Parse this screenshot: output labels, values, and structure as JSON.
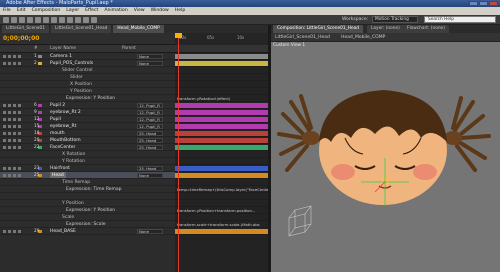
{
  "window": {
    "title": "Adobe After Effects - MaloParts_Pupil.aep *"
  },
  "menu": [
    "File",
    "Edit",
    "Composition",
    "Layer",
    "Effect",
    "Animation",
    "View",
    "Window",
    "Help"
  ],
  "toolbar": {
    "workspace_label": "Workspace:",
    "workspace_value": "Motion Tracking",
    "search_placeholder": "Search Help"
  },
  "timeline": {
    "tabs": [
      "LittleGirl_Scene01",
      "LittleGirl_Scene01_Head",
      "Head_Mobile_COMP"
    ],
    "timecode": "0;00;00;00",
    "ruler": [
      "00s",
      "05s",
      "10s"
    ],
    "columns": {
      "num": "#",
      "source": "Layer Name",
      "parent": "Parent"
    },
    "layers": [
      {
        "num": "1",
        "name": "Camera 1",
        "parent": "None",
        "label": "#8a8a8a",
        "bar": "#8a8a8a",
        "kind": "layer"
      },
      {
        "num": "2",
        "name": "Pupil_POS_Controls",
        "parent": "None",
        "label": "#c9b640",
        "bar": "#c9b640",
        "kind": "layer"
      },
      {
        "num": "",
        "name": "Slider Control",
        "parent": "",
        "label": "",
        "bar": "",
        "kind": "sub"
      },
      {
        "num": "",
        "name": "Slider",
        "parent": "",
        "label": "",
        "bar": "",
        "kind": "sub2"
      },
      {
        "num": "",
        "name": "X Position",
        "parent": "",
        "label": "",
        "bar": "",
        "kind": "sub2"
      },
      {
        "num": "",
        "name": "Y Position",
        "parent": "",
        "label": "",
        "bar": "",
        "kind": "sub2"
      },
      {
        "num": "",
        "name": "Expression: Y Position",
        "parent": "",
        "label": "",
        "bar": "",
        "expr": "transform.yRotation!(effect)",
        "kind": "prop"
      },
      {
        "num": "6",
        "name": "Pupil 2",
        "parent": "12. Pupil_R",
        "label": "#b23bb0",
        "bar": "#b23bb0",
        "kind": "layer"
      },
      {
        "num": "9",
        "name": "eyebrow_Rt 2",
        "parent": "12. Pupil_R",
        "label": "#b23bb0",
        "bar": "#b23bb0",
        "kind": "layer"
      },
      {
        "num": "12",
        "name": "Pupil",
        "parent": "12. Pupil_R",
        "label": "#b23bb0",
        "bar": "#b23bb0",
        "kind": "layer"
      },
      {
        "num": "15",
        "name": "eyebrow_Rt",
        "parent": "12. Pupil_R",
        "label": "#b23bb0",
        "bar": "#b23bb0",
        "kind": "layer"
      },
      {
        "num": "18",
        "name": "mouth",
        "parent": "25. Head",
        "label": "#b8413a",
        "bar": "#b8413a",
        "kind": "layer"
      },
      {
        "num": "20",
        "name": "MouthBottom",
        "parent": "25. Head",
        "label": "#b8413a",
        "bar": "#b8413a",
        "kind": "layer"
      },
      {
        "num": "22",
        "name": "FaceCenter",
        "parent": "25. Head",
        "label": "#3aa86a",
        "bar": "#3aa86a",
        "kind": "layer"
      },
      {
        "num": "",
        "name": "X Rotation",
        "parent": "",
        "label": "",
        "bar": "",
        "kind": "sub"
      },
      {
        "num": "",
        "name": "Y Rotation",
        "parent": "",
        "label": "",
        "bar": "",
        "kind": "sub"
      },
      {
        "num": "23",
        "name": "Hairfront",
        "parent": "25. Head",
        "label": "#3b5cc4",
        "bar": "#3b5cc4",
        "kind": "layer"
      },
      {
        "num": "25",
        "name": "Head",
        "parent": "None",
        "label": "#d48a1e",
        "bar": "#d48a1e",
        "kind": "layer",
        "selected": true
      },
      {
        "num": "",
        "name": "Time Remap",
        "parent": "",
        "label": "",
        "bar": "",
        "kind": "sub"
      },
      {
        "num": "",
        "name": "Expression: Time Remap",
        "parent": "",
        "label": "",
        "bar": "",
        "expr": "temp=timeRemap+(thisComp.layer(\"FaceCenter\").transform.rotation)/-25;",
        "kind": "prop"
      },
      {
        "num": "",
        "name": "",
        "parent": "",
        "label": "",
        "bar": "",
        "kind": "sub"
      },
      {
        "num": "",
        "name": "Y Position",
        "parent": "",
        "label": "",
        "bar": "",
        "kind": "sub"
      },
      {
        "num": "",
        "name": "Expression: Y Position",
        "parent": "",
        "label": "",
        "bar": "",
        "expr": "transform.yPosition+transform.position...",
        "kind": "prop"
      },
      {
        "num": "",
        "name": "Scale",
        "parent": "",
        "label": "",
        "bar": "",
        "kind": "sub"
      },
      {
        "num": "",
        "name": "Expression: Scale",
        "parent": "",
        "label": "",
        "bar": "",
        "expr": "transform.scale+transform.scale-(Math.abs",
        "kind": "prop"
      },
      {
        "num": "29",
        "name": "Head_BASE",
        "parent": "None",
        "label": "#d48a1e",
        "bar": "#d48a1e",
        "kind": "layer"
      }
    ]
  },
  "composition": {
    "tabs": [
      "Composition: LittleGirl_Scene01_Head",
      "Layer: (none)",
      "Flowchart: (none)"
    ],
    "breadcrumbs": [
      "LittleGirl_Scene01_Head",
      "Head_Mobile_COMP"
    ],
    "view_label": "Custom View 1"
  },
  "colors": {
    "accent": "#f2b400",
    "cti": "#e23a2a",
    "viewer_bg": "#757575"
  }
}
